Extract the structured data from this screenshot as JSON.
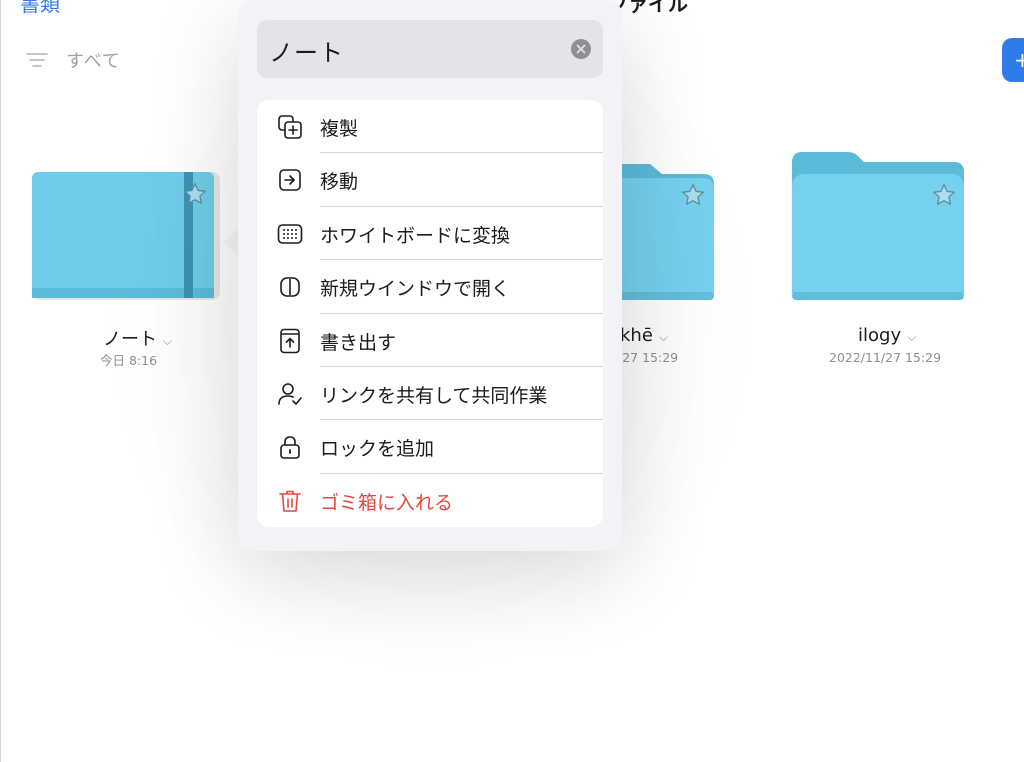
{
  "nav": {
    "back_label": "書類",
    "title": "ファイル"
  },
  "filter": {
    "label": "すべて",
    "icon": "filter-icon"
  },
  "add_button": {
    "icon": "plus-icon",
    "color": "#2f7ce8"
  },
  "items": [
    {
      "name": "ノート",
      "date": "今日 8:16",
      "type": "notebook",
      "starred": true
    },
    {
      "name": "khē",
      "date": "/27 15:29",
      "type": "folder",
      "starred": true
    },
    {
      "name": "ilogy",
      "date": "2022/11/27 15:29",
      "type": "folder",
      "starred": true
    }
  ],
  "popover": {
    "rename_value": "ノート",
    "clear_icon": "clear-icon",
    "menu": [
      {
        "label": "複製",
        "icon": "duplicate-icon",
        "destructive": false
      },
      {
        "label": "移動",
        "icon": "move-icon",
        "destructive": false
      },
      {
        "label": "ホワイトボードに変換",
        "icon": "whiteboard-icon",
        "destructive": false
      },
      {
        "label": "新規ウインドウで開く",
        "icon": "new-window-icon",
        "destructive": false
      },
      {
        "label": "書き出す",
        "icon": "export-icon",
        "destructive": false
      },
      {
        "label": "リンクを共有して共同作業",
        "icon": "collaborate-icon",
        "destructive": false
      },
      {
        "label": "ロックを追加",
        "icon": "lock-icon",
        "destructive": false
      },
      {
        "label": "ゴミ箱に入れる",
        "icon": "trash-icon",
        "destructive": true
      }
    ]
  },
  "colors": {
    "accent": "#3478f6",
    "destructive": "#e5483e",
    "folder_blue": "#76d1ee",
    "notebook_blue": "#6fcde8",
    "popover_bg": "#f2f2f7"
  }
}
